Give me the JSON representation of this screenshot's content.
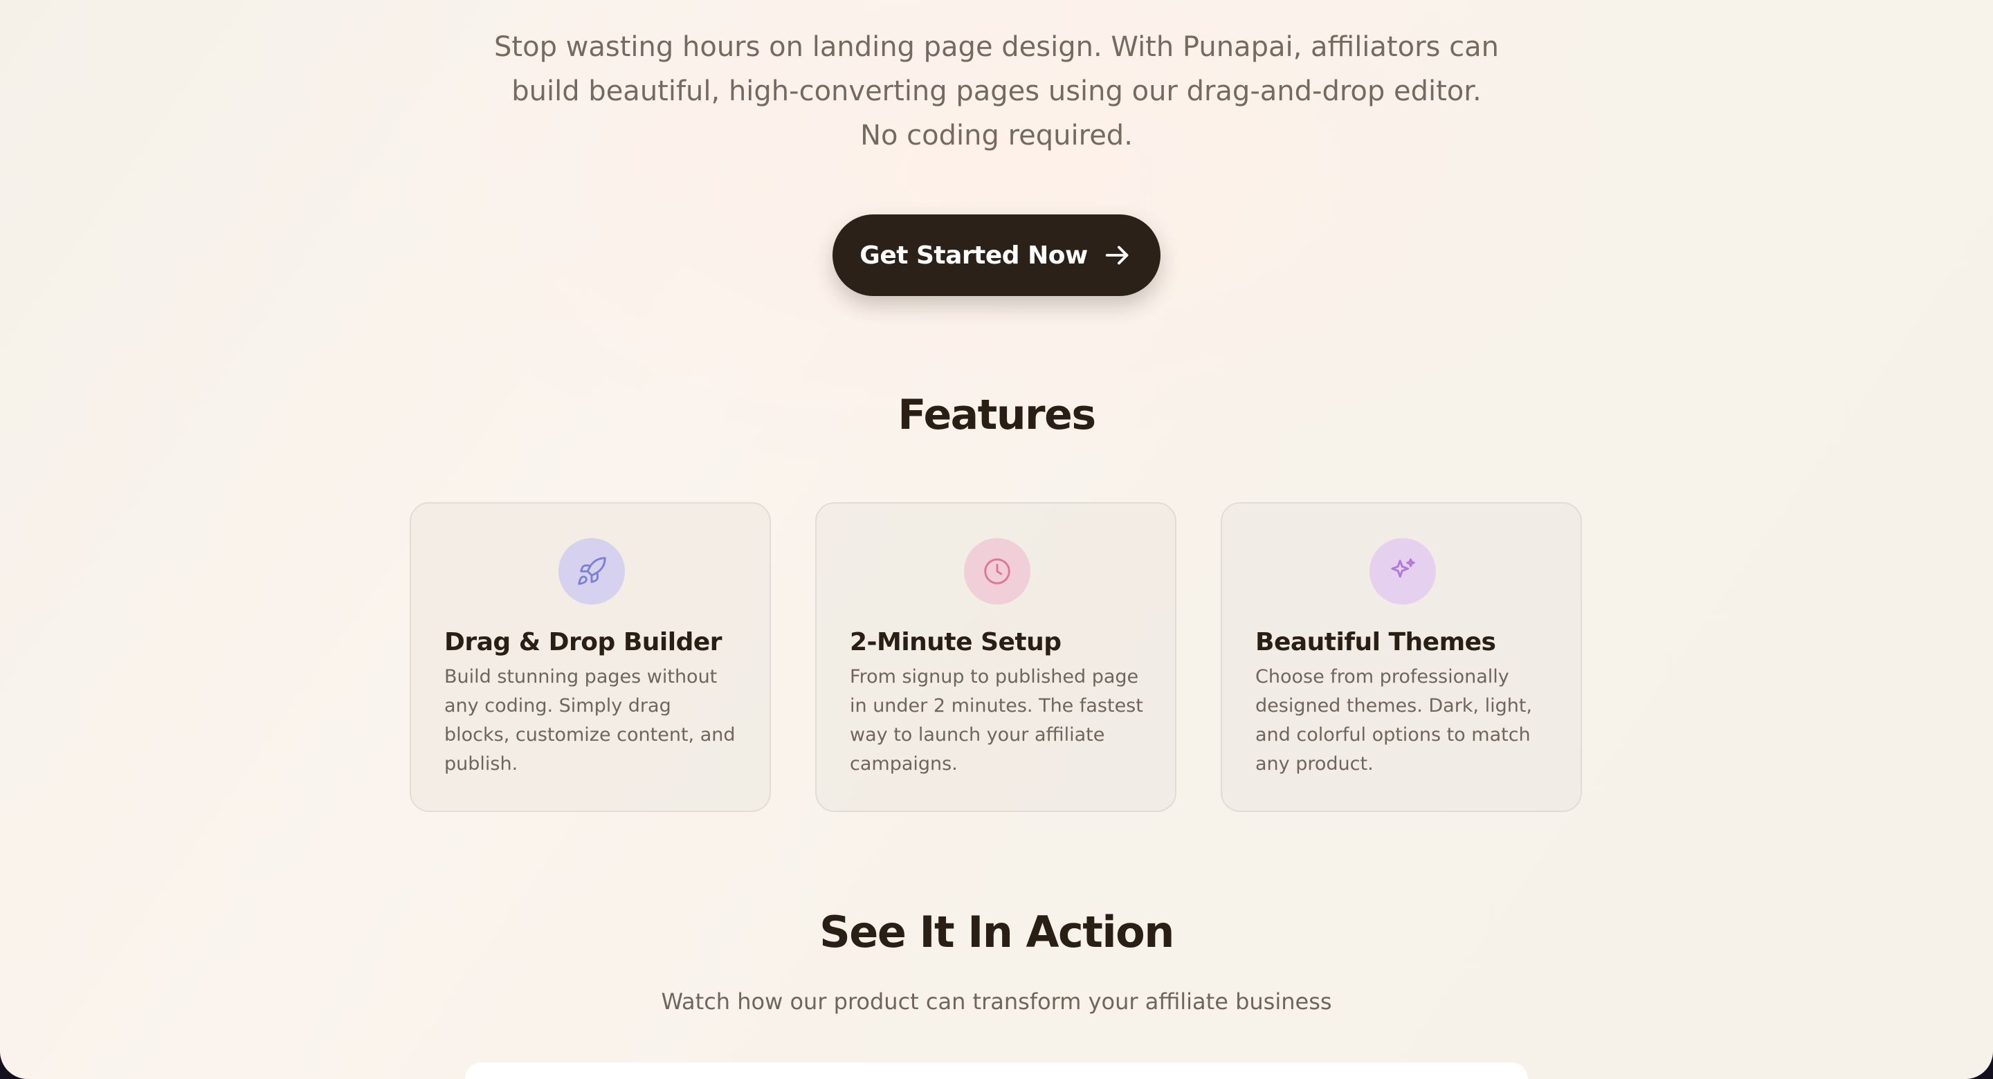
{
  "hero": {
    "description_lines": [
      "Stop wasting hours on landing page design. With Punapai, affiliators can",
      "build beautiful, high-converting pages using our drag-and-drop editor.",
      "No coding required."
    ],
    "cta_label": "Get Started Now",
    "cta_icon": "arrow-right-icon"
  },
  "features": {
    "title": "Features",
    "items": [
      {
        "icon": "rocket-icon",
        "icon_bg": "#d6d1ee",
        "icon_color": "#7b7fd6",
        "title": "Drag & Drop Builder",
        "description": "Build stunning pages without any coding. Simply drag blocks, customize content, and publish."
      },
      {
        "icon": "clock-icon",
        "icon_bg": "#f1cfd9",
        "icon_color": "#e27498",
        "title": "2-Minute Setup",
        "description": "From signup to published page in under 2 minutes. The fastest way to launch your affiliate campaigns."
      },
      {
        "icon": "sparkles-icon",
        "icon_bg": "#e6d0ef",
        "icon_color": "#b277db",
        "title": "Beautiful Themes",
        "description": "Choose from professionally designed themes. Dark, light, and colorful options to match any product."
      }
    ]
  },
  "action": {
    "title": "See It In Action",
    "subtitle": "Watch how our product can transform your affiliate business"
  },
  "colors": {
    "primary_dark": "#2b2118",
    "heading": "#2a1f15",
    "body_text": "#6f655b"
  }
}
